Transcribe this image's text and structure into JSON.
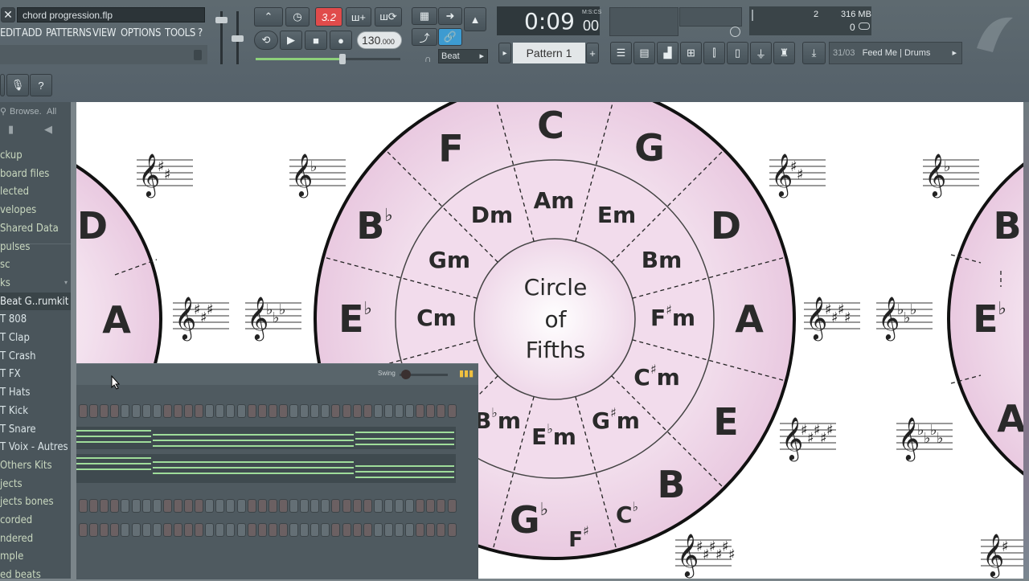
{
  "window": {
    "project_file": "chord progression.flp"
  },
  "menu": [
    "EDIT",
    "ADD",
    "PATTERNS",
    "VIEW",
    "OPTIONS",
    "TOOLS",
    "?"
  ],
  "transport": {
    "tempo": "130",
    "tempo_decimal": ".000",
    "time_main": "0:09",
    "time_sub": "00",
    "time_format": "M:S:CS",
    "snap_label": "Beat",
    "metronome_value": "3.2",
    "pattern_label": "Pattern 1"
  },
  "monitor": {
    "cpu_value": "2",
    "memory": "316 MB",
    "voices": "0"
  },
  "hint_bar": {
    "date": "31/03",
    "text": "Feed Me | Drums"
  },
  "browser": {
    "search_label": "Browse.",
    "filter_label": "All",
    "items": [
      {
        "label": "ckup",
        "type": "folder"
      },
      {
        "label": "board files",
        "type": "folder"
      },
      {
        "label": "lected",
        "type": "folder"
      },
      {
        "label": "velopes",
        "type": "folder"
      },
      {
        "label": "Shared Data",
        "type": "folder"
      },
      {
        "label": "pulses",
        "type": "folder"
      },
      {
        "label": "sc",
        "type": "folder"
      },
      {
        "label": "ks",
        "type": "folder"
      },
      {
        "label": "Beat G..rumkit",
        "type": "selected"
      },
      {
        "label": "T 808",
        "type": "inst"
      },
      {
        "label": "T Clap",
        "type": "inst"
      },
      {
        "label": "T Crash",
        "type": "inst"
      },
      {
        "label": "T FX",
        "type": "inst"
      },
      {
        "label": "T Hats",
        "type": "inst"
      },
      {
        "label": "T Kick",
        "type": "inst"
      },
      {
        "label": "T Snare",
        "type": "inst"
      },
      {
        "label": "T Voix - Autres",
        "type": "inst"
      },
      {
        "label": "Others Kits",
        "type": "folder"
      },
      {
        "label": "jects",
        "type": "folder"
      },
      {
        "label": "jects bones",
        "type": "folder"
      },
      {
        "label": "corded",
        "type": "folder"
      },
      {
        "label": "ndered",
        "type": "folder"
      },
      {
        "label": "mple",
        "type": "folder"
      },
      {
        "label": "ed beats",
        "type": "folder"
      }
    ]
  },
  "channel_rack": {
    "swing_label": "Swing"
  },
  "circle": {
    "center_lines": [
      "Circle",
      "of",
      "Fifths"
    ],
    "outer": {
      "C": "C",
      "G": "G",
      "D": "D",
      "A": "A",
      "E": "E",
      "B": "B",
      "F": "F",
      "Bb_base": "B",
      "Eb_base": "E",
      "Gb_base": "G",
      "Fs_base": "F",
      "Cb_base": "C",
      "flat": "♭",
      "sharp": "♯"
    },
    "inner": {
      "Am": "Am",
      "Em": "Em",
      "Bm": "Bm",
      "Fsm_base": "F",
      "Csm_base": "C",
      "Gsm_base": "G",
      "Ebm_base": "E",
      "Bbm_base": "B",
      "Dm": "Dm",
      "Gm": "Gm",
      "Cm": "Cm",
      "m": "m"
    },
    "left_partial": {
      "D": "D",
      "A": "A"
    },
    "right_partial": {
      "B": "B",
      "E": "E",
      "A": "A"
    }
  },
  "colors": {
    "toolbar_bg": "#5b676e",
    "circle_fill": "#edd3e6",
    "circle_center": "#f7ecf4",
    "time_text": "#e9eef0",
    "tempo_red": "#e04b4b",
    "browser_text": "#c9d8bf"
  }
}
